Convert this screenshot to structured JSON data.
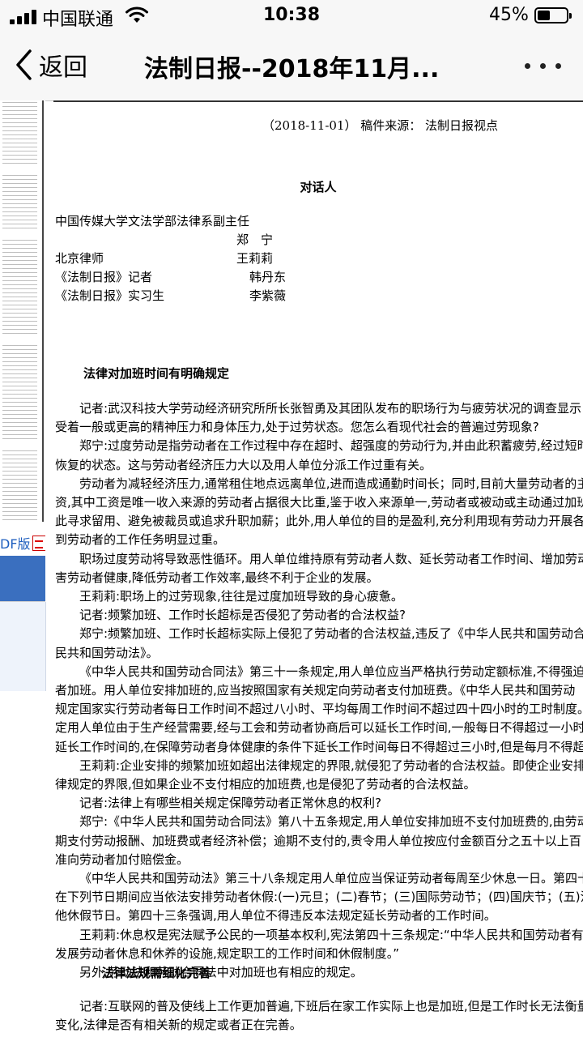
{
  "status_bar": {
    "carrier": "中国联通",
    "time": "10:38",
    "battery_percent": "45%",
    "battery_level": 0.45
  },
  "nav": {
    "back_label": "返回",
    "title": "法制日报--2018年11月...",
    "more_icon": "more-dots-icon"
  },
  "sidebar": {
    "pdf_label": "DF版"
  },
  "article": {
    "meta": "（2018-11-01） 稿件来源： 法制日报视点",
    "section_dialogue": "对话人",
    "people": [
      {
        "role": "中国传媒大学文法学部法律系副主任",
        "name": "郑　宁"
      },
      {
        "role": "北京律师",
        "name": "王莉莉"
      },
      {
        "role": "《法制日报》记者",
        "name": "韩丹东"
      },
      {
        "role": "《法制日报》实习生",
        "name": "李紫薇"
      }
    ],
    "heading1": "法律对加班时间有明确规定",
    "body1": [
      "记者:武汉科技大学劳动经济研究所所长张智勇及其团队发布的职场行为与疲劳状况的调查显示",
      "受着一般或更高的精神压力和身体压力,处于过劳状态。您怎么看现代社会的普遍过劳现象?",
      "郑宁:过度劳动是指劳动者在工作过程中存在超时、超强度的劳动行为,并由此积蓄疲劳,经过短时",
      "恢复的状态。这与劳动者经济压力大以及用人单位分派工作过重有关。",
      "劳动者为减轻经济压力,通常租住地点远离单位,进而造成通勤时间长；同时,目前大量劳动者的主",
      "资,其中工资是唯一收入来源的劳动者占据很大比重,鉴于收入来源单一,劳动者或被动或主动通过加班",
      "此寻求留用、避免被裁员或追求升职加薪；此外,用人单位的目的是盈利,充分利用现有劳动力开展各",
      "到劳动者的工作任务明显过重。",
      "职场过度劳动将导致恶性循环。用人单位维持原有劳动者人数、延长劳动者工作时间、增加劳动",
      "害劳动者健康,降低劳动者工作效率,最终不利于企业的发展。",
      "王莉莉:职场上的过劳现象,往往是过度加班导致的身心疲惫。",
      "记者:频繁加班、工作时长超标是否侵犯了劳动者的合法权益?",
      "郑宁:频繁加班、工作时长超标实际上侵犯了劳动者的合法权益,违反了《中华人民共和国劳动合",
      "民共和国劳动法》。",
      "《中华人民共和国劳动合同法》第三十一条规定,用人单位应当严格执行劳动定额标准,不得强迫",
      "者加班。用人单位安排加班的,应当按照国家有关规定向劳动者支付加班费。《中华人民共和国劳动",
      "规定国家实行劳动者每日工作时间不超过八小时、平均每周工作时间不超过四十四小时的工时制度。",
      "定用人单位由于生产经营需要,经与工会和劳动者协商后可以延长工作时间,一般每日不得超过一小时",
      "延长工作时间的,在保障劳动者身体健康的条件下延长工作时间每日不得超过三小时,但是每月不得超",
      "王莉莉:企业安排的频繁加班如超出法律规定的界限,就侵犯了劳动者的合法权益。即使企业安排",
      "律规定的界限,但如果企业不支付相应的加班费,也是侵犯了劳动者的合法权益。",
      "记者:法律上有哪些相关规定保障劳动者正常休息的权利?",
      "郑宁:《中华人民共和国劳动合同法》第八十五条规定,用人单位安排加班不支付加班费的,由劳动",
      "期支付劳动报酬、加班费或者经济补偿；逾期不支付的,责令用人单位按应付金额百分之五十以上百",
      "准向劳动者加付赔偿金。",
      "《中华人民共和国劳动法》第三十八条规定用人单位应当保证劳动者每周至少休息一日。第四十",
      "在下列节日期间应当依法安排劳动者休假:(一)元旦；(二)春节；(三)国际劳动节；(四)国庆节；(五)法",
      "他休假节日。第四十三条强调,用人单位不得违反本法规定延长劳动者的工作时间。",
      "王莉莉:休息权是宪法赋予公民的一项基本权利,宪法第四十三条规定:“中华人民共和国劳动者有",
      "发展劳动者休息和休养的设施,规定职工的工作时间和休假制度。”",
      "另外,劳动法和劳动合同法中对加班也有相应的规定。"
    ],
    "heading2": "法律法规需细化完善",
    "body2": [
      "记者:互联网的普及使线上工作更加普遍,下班后在家工作实际上也是加班,但是工作时长无法衡量",
      "变化,法律是否有相关新的规定或者正在完善。"
    ]
  }
}
